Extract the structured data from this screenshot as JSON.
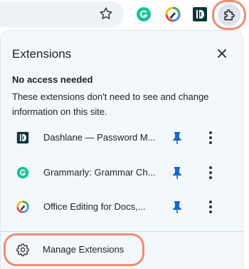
{
  "colors": {
    "highlight_ring": "#f08b70",
    "pin_blue": "#1a66d2",
    "grammarly_green": "#15c39a",
    "dashlane_navy": "#0e353d",
    "popup_bg": "#f3f8fd"
  },
  "toolbar": {
    "icons": [
      "star-icon",
      "grammarly-icon",
      "office-editing-icon",
      "dashlane-icon",
      "puzzle-icon"
    ]
  },
  "popup": {
    "title": "Extensions",
    "close_icon": "close-icon",
    "section_heading": "No access needed",
    "section_description": "These extensions don't need to see and change information on this site.",
    "extensions": [
      {
        "name": "Dashlane — Password M...",
        "icon": "dashlane-icon",
        "pinned": true
      },
      {
        "name": "Grammarly: Grammar Ch...",
        "icon": "grammarly-icon",
        "pinned": true
      },
      {
        "name": "Office Editing for Docs,...",
        "icon": "office-editing-icon",
        "pinned": true
      }
    ],
    "manage_label": "Manage Extensions"
  }
}
